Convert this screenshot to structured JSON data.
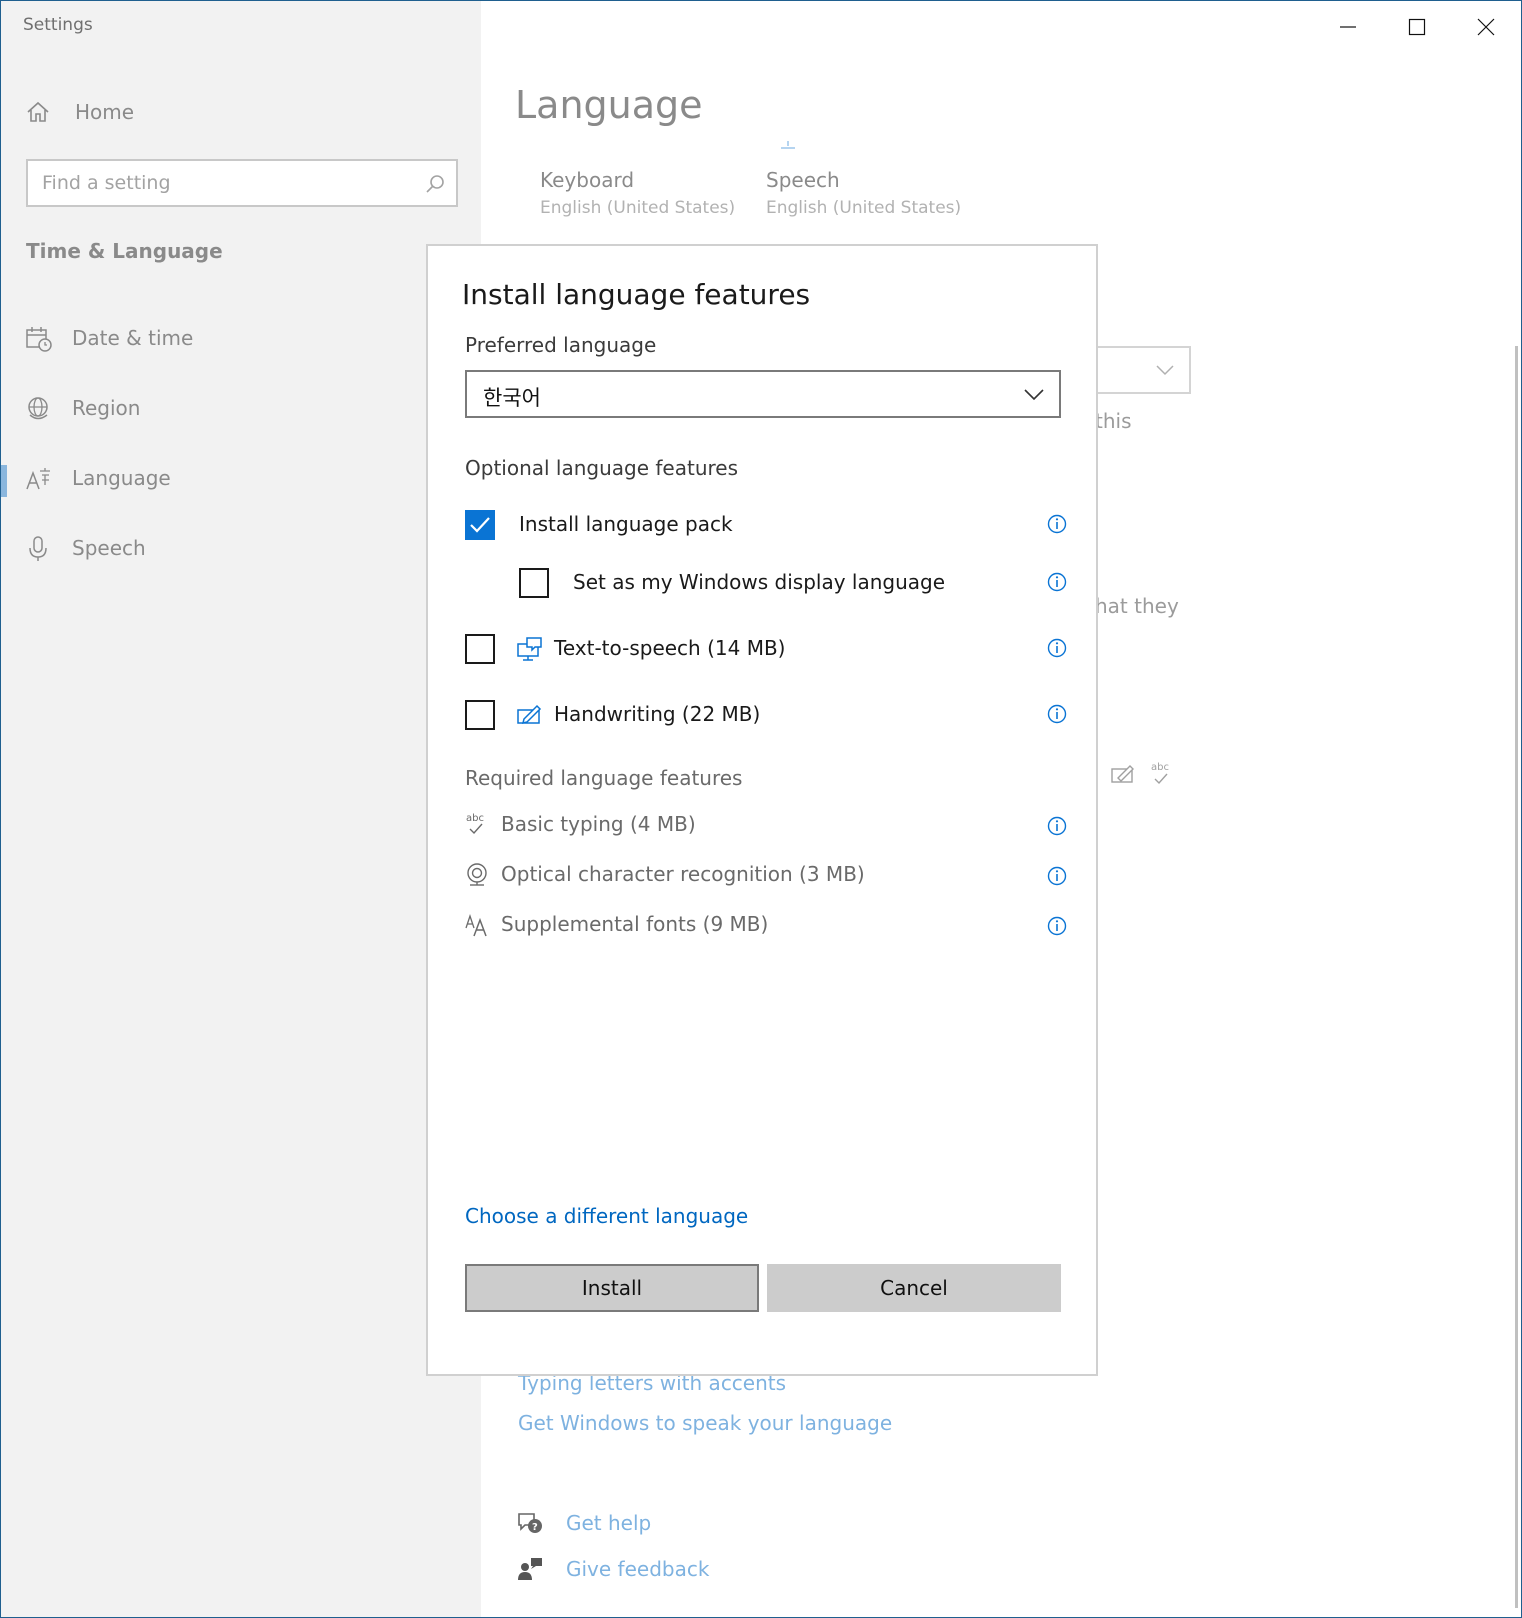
{
  "window": {
    "app_title": "Settings"
  },
  "sidebar": {
    "home_label": "Home",
    "search_placeholder": "Find a setting",
    "section_title": "Time & Language",
    "items": [
      {
        "label": "Date & time",
        "icon": "calendar-clock-icon"
      },
      {
        "label": "Region",
        "icon": "globe-icon"
      },
      {
        "label": "Language",
        "icon": "language-icon",
        "selected": true
      },
      {
        "label": "Speech",
        "icon": "microphone-icon"
      }
    ]
  },
  "main": {
    "title": "Language",
    "tiles": [
      {
        "title": "Keyboard",
        "subtitle": "English (United States)"
      },
      {
        "title": "Speech",
        "subtitle": "English (United States)"
      }
    ],
    "fragments": {
      "this": "this",
      "what_they": "hat they"
    },
    "links": [
      "Typing letters with accents",
      "Get Windows to speak your language"
    ],
    "help": {
      "get_help": "Get help",
      "give_feedback": "Give feedback"
    }
  },
  "dialog": {
    "title": "Install language features",
    "preferred_label": "Preferred language",
    "preferred_value": "한국어",
    "optional_title": "Optional language features",
    "optional": [
      {
        "label": "Install language pack",
        "checked": true
      },
      {
        "label": "Set as my Windows display language",
        "checked": false
      },
      {
        "label": "Text-to-speech (14 MB)",
        "checked": false,
        "icon": "text-to-speech-icon"
      },
      {
        "label": "Handwriting (22 MB)",
        "checked": false,
        "icon": "handwriting-icon"
      }
    ],
    "required_title": "Required language features",
    "required": [
      {
        "label": "Basic typing (4 MB)",
        "icon": "abc-check-icon"
      },
      {
        "label": "Optical character recognition (3 MB)",
        "icon": "camera-ocr-icon"
      },
      {
        "label": "Supplemental fonts (9 MB)",
        "icon": "fonts-icon"
      }
    ],
    "choose_link": "Choose a different language",
    "install_label": "Install",
    "cancel_label": "Cancel"
  },
  "colors": {
    "accent": "#0a74d4",
    "link": "#0067c0",
    "button": "#cccccc"
  }
}
